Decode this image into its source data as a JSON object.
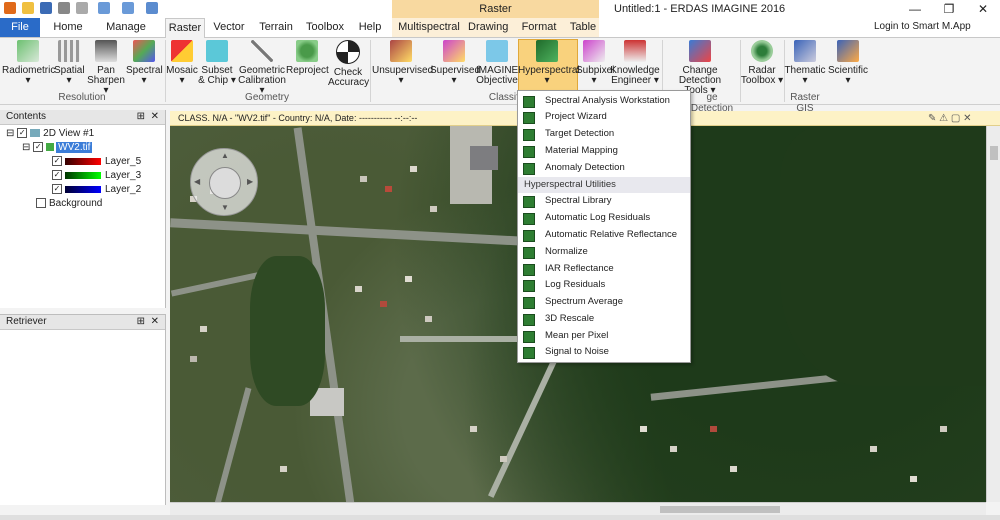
{
  "window": {
    "title": "Untitled:1 - ERDAS IMAGINE 2016",
    "contextual_header": "Raster",
    "controls": [
      "—",
      "❐",
      "✕"
    ],
    "login": "Login to Smart M.App"
  },
  "tabs": [
    "File",
    "Home",
    "Manage Data",
    "Raster",
    "Vector",
    "Terrain",
    "Toolbox",
    "Help",
    "Multispectral",
    "Drawing",
    "Format",
    "Table"
  ],
  "active_tab": "Raster",
  "ribbon": {
    "buttons": [
      {
        "l1": "Radiometric",
        "l2": "▾"
      },
      {
        "l1": "Spatial",
        "l2": "▾"
      },
      {
        "l1": "Pan",
        "l2": "Sharpen ▾"
      },
      {
        "l1": "Spectral",
        "l2": "▾"
      },
      {
        "l1": "Mosaic",
        "l2": "▾"
      },
      {
        "l1": "Subset",
        "l2": "& Chip ▾"
      },
      {
        "l1": "Geometric",
        "l2": "Calibration ▾"
      },
      {
        "l1": "Reproject",
        "l2": ""
      },
      {
        "l1": "Check",
        "l2": "Accuracy"
      },
      {
        "l1": "Unsupervised",
        "l2": "▾"
      },
      {
        "l1": "Supervised",
        "l2": "▾"
      },
      {
        "l1": "IMAGINE",
        "l2": "Objective"
      },
      {
        "l1": "Hyperspectral",
        "l2": "▾"
      },
      {
        "l1": "Subpixel",
        "l2": "▾"
      },
      {
        "l1": "Knowledge",
        "l2": "Engineer ▾"
      },
      {
        "l1": "Change Detection",
        "l2": "Tools ▾"
      },
      {
        "l1": "Radar",
        "l2": "Toolbox ▾"
      },
      {
        "l1": "Thematic",
        "l2": "▾"
      },
      {
        "l1": "Scientific",
        "l2": "▾"
      }
    ],
    "groups": [
      "Resolution",
      "Geometry",
      "Classifi",
      "ge Detection",
      "Raster GIS"
    ]
  },
  "contents": {
    "title": "Contents",
    "view": "2D View #1",
    "file": "WV2.tif",
    "layers": [
      "Layer_5",
      "Layer_3",
      "Layer_2"
    ],
    "background": "Background"
  },
  "retriever": {
    "title": "Retriever"
  },
  "viewer": {
    "header": "CLASS. N/A - \"WV2.tif\" - Country: N/A, Date: ----------- --:--:--"
  },
  "hyperspectral_menu": {
    "items": [
      "Spectral Analysis Workstation",
      "Project Wizard",
      "Target Detection",
      "Material Mapping",
      "Anomaly Detection"
    ],
    "section": "Hyperspectral Utilities",
    "utilities": [
      "Spectral Library",
      "Automatic Log Residuals",
      "Automatic Relative Reflectance",
      "Normalize",
      "IAR Reflectance",
      "Log Residuals",
      "Spectrum Average",
      "3D Rescale",
      "Mean per Pixel",
      "Signal to Noise"
    ]
  },
  "colors": {
    "file_tab": "#2a6bc8",
    "context_tab": "#f8d9a0",
    "highlight": "#f9d27d",
    "menu_icon": "#2e7d32"
  }
}
